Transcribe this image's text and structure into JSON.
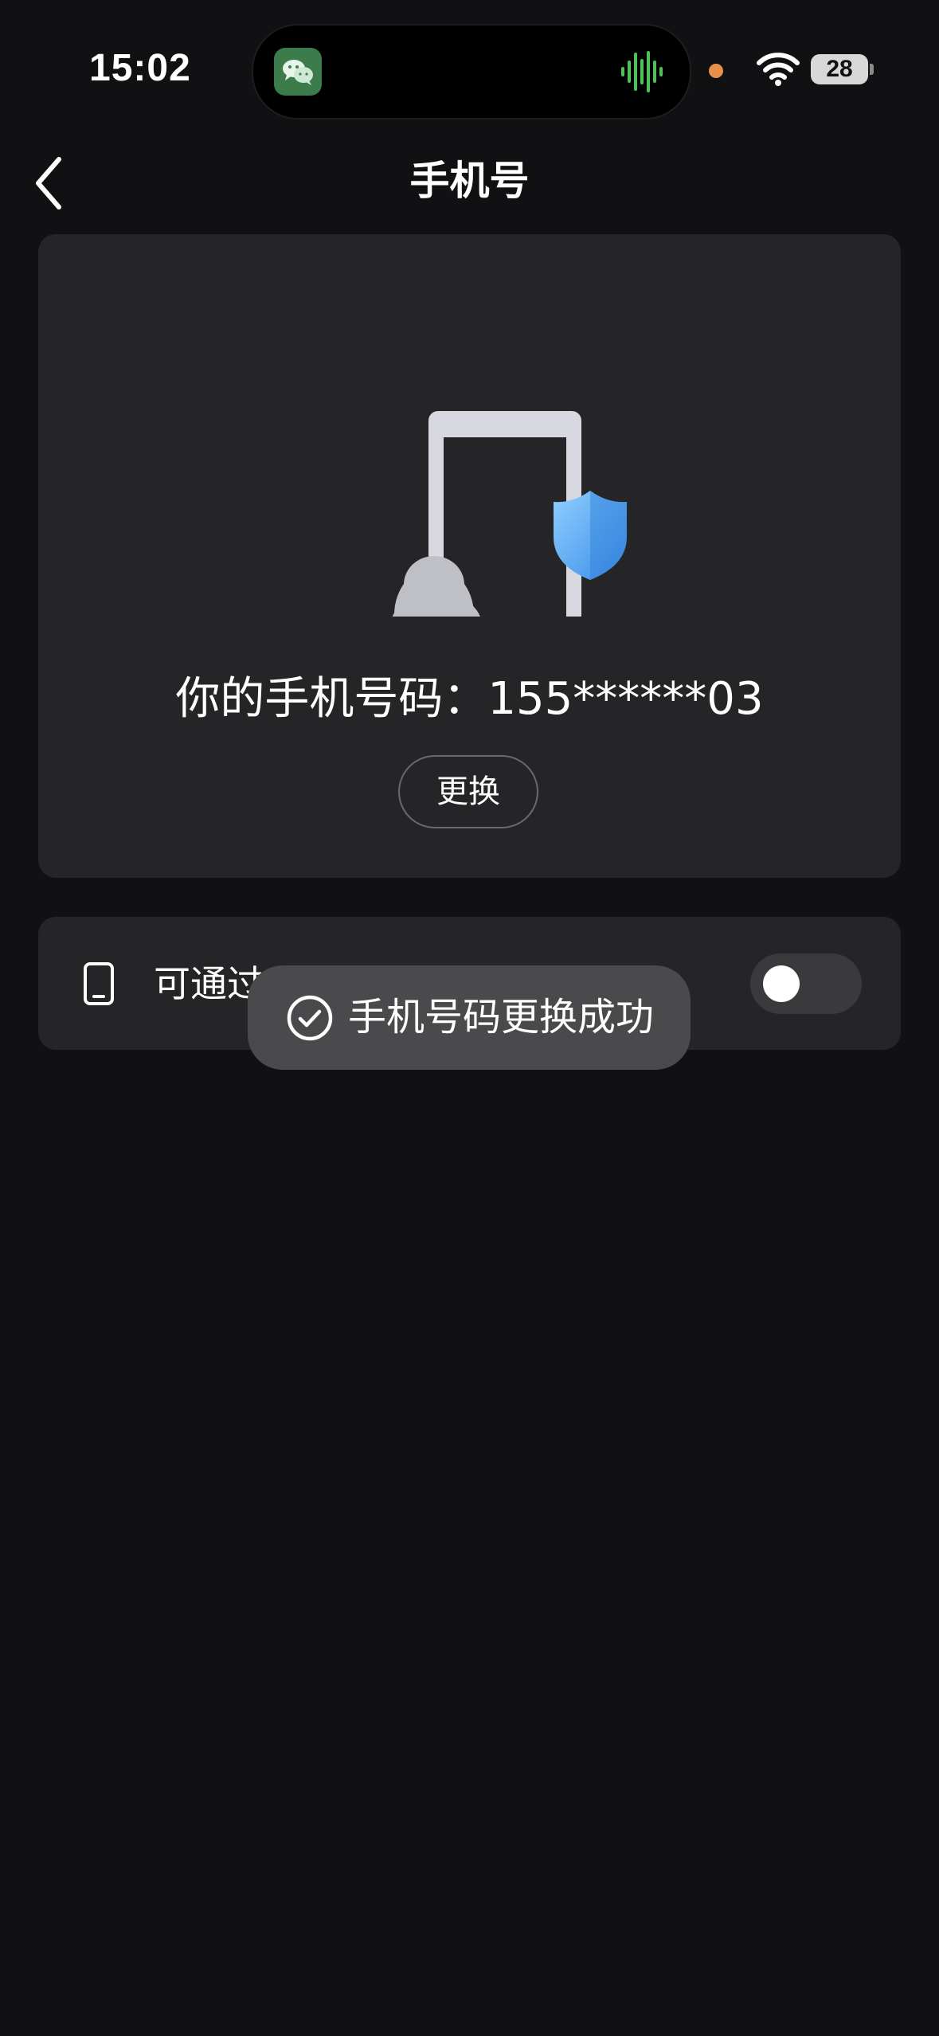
{
  "status_bar": {
    "time": "15:02",
    "battery": "28",
    "live_activity_app_icon": "wechat-icon",
    "live_activity_indicator": "audio-wave-icon",
    "wave_color": "#4cc15a"
  },
  "nav": {
    "back_icon": "chevron-left-icon",
    "title": "手机号"
  },
  "phone_card": {
    "illustration": "phone-shield-penguin-illustration",
    "phone_text": "你的手机号码：155******03",
    "change_label": "更换"
  },
  "setting": {
    "icon": "phone-device-icon",
    "label": "可通过",
    "toggle_on": false
  },
  "toast": {
    "icon": "check-circle-icon",
    "message": "手机号码更换成功"
  },
  "colors": {
    "background": "#111113",
    "card": "#252528",
    "toast": "#4a4a4d",
    "shield": "#4a9ef0"
  }
}
